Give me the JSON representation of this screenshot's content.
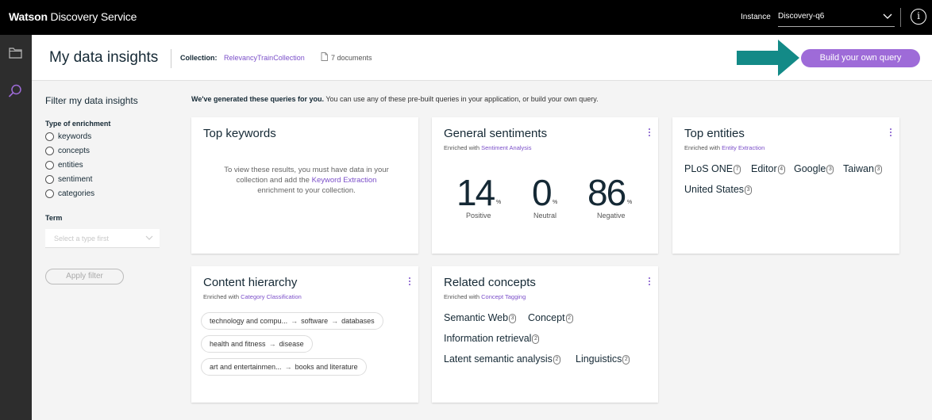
{
  "topbar": {
    "brand_bold": "Watson",
    "brand_rest": " Discovery Service",
    "instance_label": "Instance",
    "instance_value": "Discovery-q6"
  },
  "header": {
    "title": "My data insights",
    "collection_label": "Collection:",
    "collection_name": "RelevancyTrainCollection",
    "doc_count": "7 documents",
    "build_button": "Build your own query"
  },
  "filter": {
    "title": "Filter my data insights",
    "enrichment_label": "Type of enrichment",
    "enrichment_options": [
      "keywords",
      "concepts",
      "entities",
      "sentiment",
      "categories"
    ],
    "term_label": "Term",
    "term_placeholder": "Select a type first",
    "apply_button": "Apply filter"
  },
  "main": {
    "intro_bold": "We've generated these queries for you.",
    "intro_rest": " You can use any of these pre-built queries in your application, or build your own query."
  },
  "cards": {
    "keywords": {
      "title": "Top keywords",
      "msg_1": "To view these results, you must have data in your collection and add the ",
      "msg_link": "Keyword Extraction",
      "msg_2": " enrichment to your collection."
    },
    "sentiments": {
      "title": "General sentiments",
      "sub_prefix": "Enriched with ",
      "sub_link": "Sentiment Analysis",
      "positive_value": "14",
      "neutral_value": "0",
      "negative_value": "86",
      "pct": "%",
      "positive_label": "Positive",
      "neutral_label": "Neutral",
      "negative_label": "Negative"
    },
    "entities": {
      "title": "Top entities",
      "sub_prefix": "Enriched with ",
      "sub_link": "Entity Extraction",
      "items": [
        {
          "label": "PLoS ONE",
          "count": "7"
        },
        {
          "label": "Editor",
          "count": "4"
        },
        {
          "label": "Google",
          "count": "3"
        },
        {
          "label": "Taiwan",
          "count": "3"
        },
        {
          "label": "United States",
          "count": "3"
        }
      ]
    },
    "hierarchy": {
      "title": "Content hierarchy",
      "sub_prefix": "Enriched with ",
      "sub_link": "Category Classification",
      "paths": [
        [
          "technology and compu...",
          "software",
          "databases"
        ],
        [
          "health and fitness",
          "disease"
        ],
        [
          "art and entertainmen...",
          "books and literature"
        ]
      ],
      "arrow": "→"
    },
    "concepts": {
      "title": "Related concepts",
      "sub_prefix": "Enriched with ",
      "sub_link": "Concept Tagging",
      "items": [
        {
          "label": "Semantic Web",
          "count": "3"
        },
        {
          "label": "Concept",
          "count": "2"
        },
        {
          "label": "Information retrieval",
          "count": "2"
        },
        {
          "label": "Latent semantic analysis",
          "count": "2"
        },
        {
          "label": "Linguistics",
          "count": "2"
        }
      ]
    }
  },
  "colors": {
    "accent": "#9e6bd8",
    "link": "#7b4fc9",
    "arrow": "#138a87",
    "topbar": "#000000",
    "rail": "#2d2d2d"
  },
  "icons": [
    "folder-icon",
    "search-icon",
    "info-icon",
    "chevron-down-icon",
    "document-icon",
    "overflow-menu-icon",
    "arrow-right-icon"
  ]
}
